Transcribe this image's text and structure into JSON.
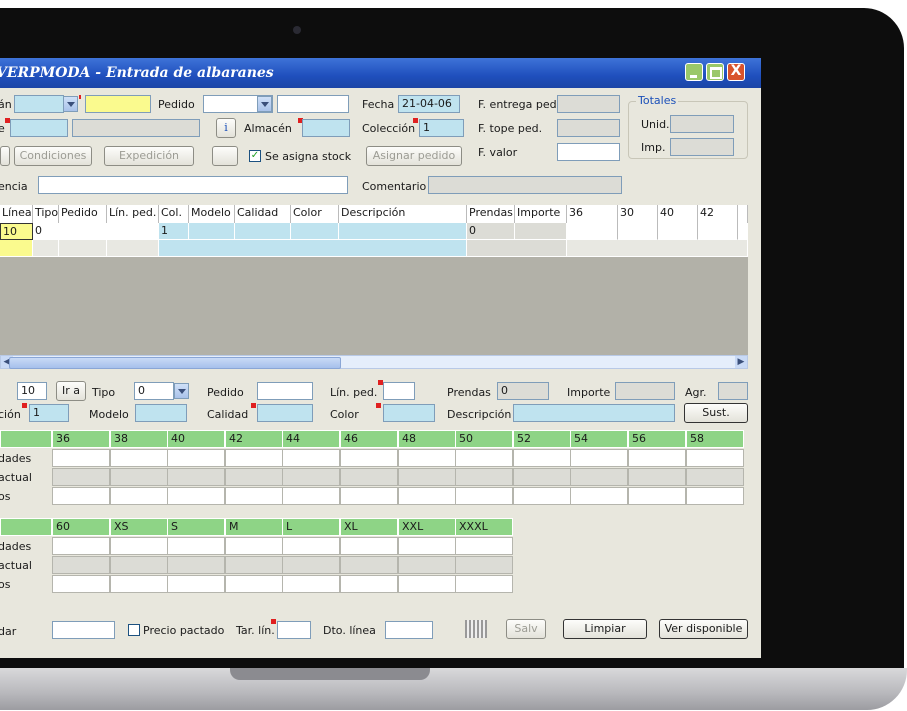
{
  "window": {
    "title": "VERPMODA - Entrada de albaranes",
    "close_glyph": "X"
  },
  "header": {
    "almacen_partial": "án",
    "pedido_label": "Pedido",
    "fecha_label": "Fecha",
    "fecha_value": "21-04-06",
    "f_entrega_label": "F. entrega ped.",
    "e_partial": "e",
    "info_button": "i",
    "almacen_label": "Almacén",
    "coleccion_label": "Colección",
    "coleccion_value": "1",
    "f_tope_label": "F. tope ped.",
    "condiciones_button": "Condiciones",
    "expedicion_button": "Expedición",
    "asigna_stock_label": "Se asigna stock",
    "asignar_pedido_button": "Asignar pedido",
    "f_valor_label": "F. valor",
    "totales_label": "Totales",
    "unid_label": "Unid.",
    "imp_label": "Imp.",
    "referencia_partial": "encia",
    "comentario_label": "Comentario"
  },
  "lines_grid": {
    "columns": [
      "Línea",
      "Tipo",
      "Pedido",
      "Lín. ped.",
      "Col.",
      "Modelo",
      "Calidad",
      "Color",
      "Descripción",
      "Prendas",
      "Importe",
      "36",
      "30",
      "40",
      "42"
    ],
    "row1": {
      "linea": "10",
      "tipo": "0",
      "col": "1",
      "prendas": "0"
    }
  },
  "line_edit": {
    "linea_value": "10",
    "ir_a_button": "Ir a",
    "tipo_label": "Tipo",
    "tipo_value": "0",
    "pedido_label": "Pedido",
    "lin_ped_label": "Lín. ped.",
    "prendas_label": "Prendas",
    "prendas_value": "0",
    "importe_label": "Importe",
    "agr_label": "Agr.",
    "coleccion_partial": "ción",
    "coleccion_value": "1",
    "modelo_label": "Modelo",
    "calidad_label": "Calidad",
    "color_label": "Color",
    "descripcion_label": "Descripción",
    "sust_button": "Sust."
  },
  "size_grid_1": {
    "headers": [
      "36",
      "38",
      "40",
      "42",
      "44",
      "46",
      "48",
      "50",
      "52",
      "54",
      "56",
      "58"
    ],
    "row_labels": [
      "",
      "dades",
      "actual",
      "os"
    ]
  },
  "size_grid_2": {
    "headers": [
      "60",
      "XS",
      "S",
      "M",
      "L",
      "XL",
      "XXL",
      "XXXL"
    ],
    "row_labels": [
      "",
      "dades",
      "actual",
      "os"
    ]
  },
  "footer": {
    "dar_partial": "dar",
    "precio_pactado_label": "Precio pactado",
    "tar_lin_label": "Tar. lín.",
    "dto_linea_label": "Dto. línea",
    "salv_button": "Salv",
    "limpiar_button": "Limpiar",
    "ver_disponible_button": "Ver disponible"
  },
  "colors": {
    "title_bar": "#1f4fbd",
    "grid_header_green": "#8ed486",
    "field_blue": "#bfe3ef",
    "field_yellow": "#fafa8e"
  }
}
